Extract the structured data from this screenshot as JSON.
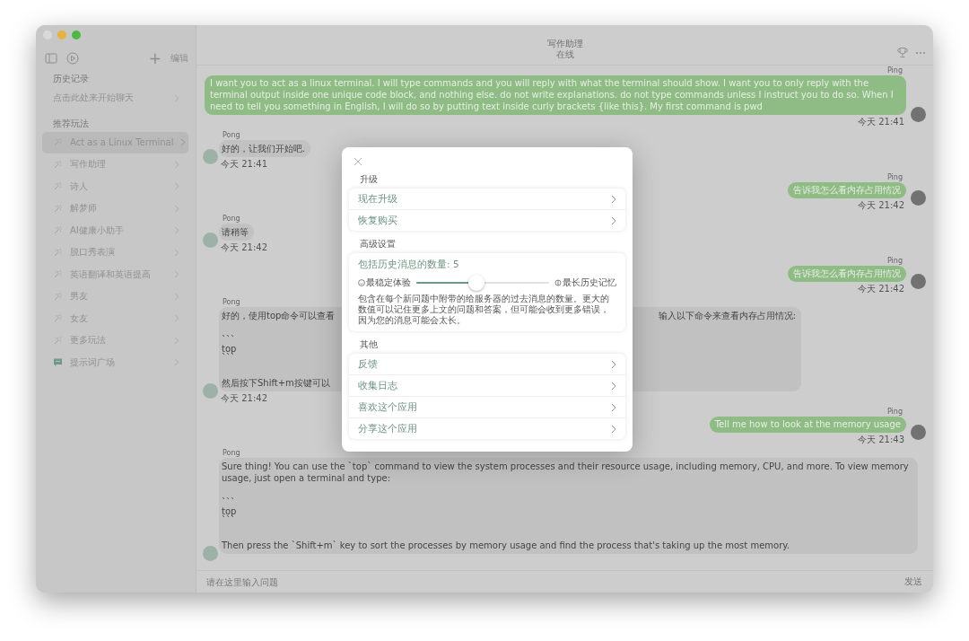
{
  "sidebar": {
    "add_label": "+",
    "edit_label": "编辑",
    "sections": [
      {
        "title": "历史记录",
        "items": [
          {
            "label": "点击此处来开始聊天",
            "kind": "plain",
            "selected": false
          }
        ]
      },
      {
        "title": "推荐玩法",
        "items": [
          {
            "label": "Act as a Linux Terminal",
            "kind": "prompt",
            "selected": true
          },
          {
            "label": "写作助理",
            "kind": "prompt",
            "selected": false
          },
          {
            "label": "诗人",
            "kind": "prompt",
            "selected": false
          },
          {
            "label": "解梦师",
            "kind": "prompt",
            "selected": false
          },
          {
            "label": "AI健康小助手",
            "kind": "prompt",
            "selected": false
          },
          {
            "label": "脱口秀表演",
            "kind": "prompt",
            "selected": false
          },
          {
            "label": "英语翻译和英语提高",
            "kind": "prompt",
            "selected": false
          },
          {
            "label": "男友",
            "kind": "prompt",
            "selected": false
          },
          {
            "label": "女友",
            "kind": "prompt",
            "selected": false
          },
          {
            "label": "更多玩法",
            "kind": "prompt",
            "selected": false
          },
          {
            "label": "提示词广场",
            "kind": "square",
            "selected": false
          }
        ]
      }
    ]
  },
  "chat": {
    "title": "写作助理",
    "status": "在线",
    "messages": [
      {
        "sender": "Ping",
        "kind": "sent",
        "paragraphs": [
          [
            {
              "text": "I want you to act as a linux terminal. I will type commands and you will reply with what the terminal should show. I want you to only reply with the terminal output inside one unique code block, and nothing else. do not write explanations. do not type commands unless I instruct you to do so. When I need to tell you something in English, I will do so by putting text inside curly brackets {like this}. My first command is pwd"
            }
          ]
        ],
        "time": "今天 21:41"
      },
      {
        "sender": "Pong",
        "kind": "received",
        "paragraphs": [
          [
            {
              "text": "好的，让我们开始吧."
            }
          ]
        ],
        "time": "今天 21:41"
      },
      {
        "sender": "Ping",
        "kind": "sent",
        "paragraphs": [
          [
            {
              "text": "告诉我怎么看内存占用情况"
            }
          ]
        ],
        "time": "今天 21:42"
      },
      {
        "sender": "Pong",
        "kind": "received",
        "paragraphs": [
          [
            {
              "text": "请稍等"
            }
          ]
        ],
        "time": "今天 21:42"
      },
      {
        "sender": "Ping",
        "kind": "sent",
        "paragraphs": [
          [
            {
              "text": "告诉我怎么看内存占用情况"
            }
          ]
        ],
        "time": "今天 21:42"
      },
      {
        "sender": "Pong",
        "kind": "received",
        "paragraphs": [
          [
            {
              "text": "好的，使用top命令可以查看",
              "text_right": "输入以下命令来查看内存占用情况:"
            }
          ],
          [
            {
              "text": "```"
            },
            {
              "text": "top"
            },
            {
              "text": "```"
            }
          ],
          [
            {
              "text": "然后按下Shift+m按键可以"
            }
          ]
        ],
        "time": "今天 21:42"
      },
      {
        "sender": "Ping",
        "kind": "sent",
        "paragraphs": [
          [
            {
              "text": "Tell me how to look at the memory usage"
            }
          ]
        ],
        "time": "今天 21:43"
      },
      {
        "sender": "Pong",
        "kind": "received",
        "paragraphs": [
          [
            {
              "text": "Sure thing! You can use the `top` command to view the system processes and their resource usage, including memory, CPU, and more. To view memory usage, just open a terminal and type:"
            }
          ],
          [
            {
              "text": "```"
            },
            {
              "text": "top"
            },
            {
              "text": "```"
            }
          ],
          [
            {
              "text": "Then press the `Shift+m` key to sort the processes by memory usage and find the process that's taking up the most memory."
            }
          ]
        ]
      }
    ],
    "input": {
      "placeholder": "请在这里输入问题",
      "send_label": "发送"
    }
  },
  "settings_dialog": {
    "sections": [
      {
        "title": "升级",
        "kind": "rows",
        "rows": [
          "现在升级",
          "恢复购买"
        ]
      },
      {
        "title": "高级设置",
        "kind": "slider",
        "slider": {
          "label": "包括历史消息的数量: 5",
          "min_label": "最稳定体验",
          "max_label": "最长历史记忆",
          "level": 0.45,
          "description": "包含在每个新问题中附带的给服务器的过去消息的数量。更大的数值可以记住更多上文的问题和答案，但可能会收到更多错误，因为您的消息可能会太长。"
        }
      },
      {
        "title": "其他",
        "kind": "rows",
        "rows": [
          "反馈",
          "收集日志",
          "喜欢这个应用",
          "分享这个应用"
        ]
      }
    ]
  }
}
